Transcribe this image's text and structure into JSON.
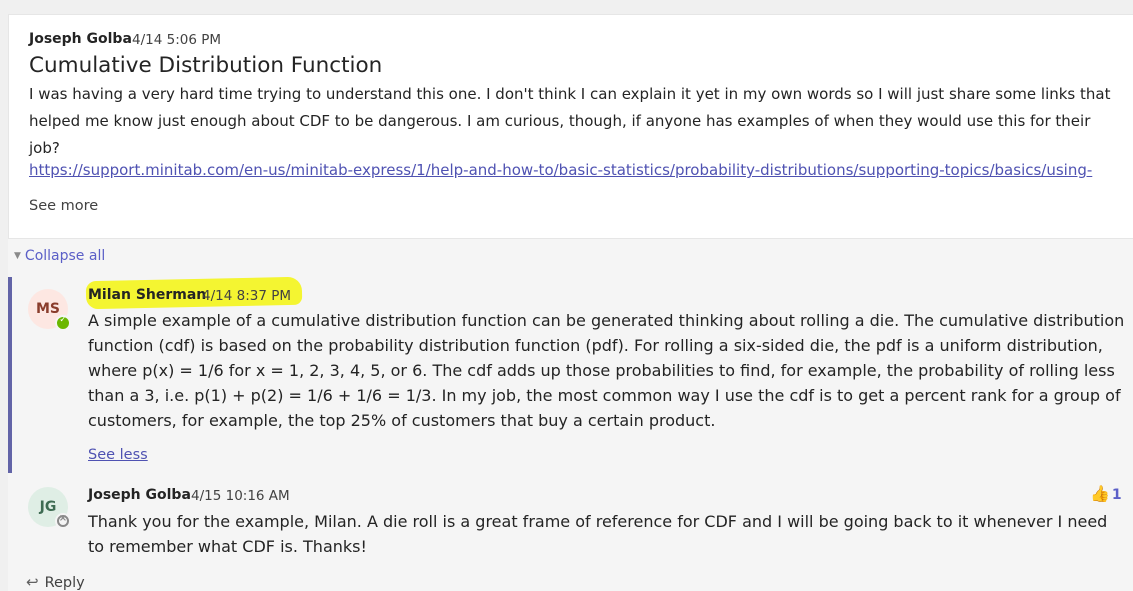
{
  "post": {
    "author": "Joseph Golba",
    "time": "4/14 5:06 PM",
    "title": "Cumulative Distribution Function",
    "body": "I was having a very hard time trying to understand this one.  I don't think I can explain it yet in my own words so I will just share some links that helped me know just enough about CDF to be dangerous.  I am curious, though, if anyone has examples of when they would use this for their job?",
    "link": "https://support.minitab.com/en-us/minitab-express/1/help-and-how-to/basic-statistics/probability-distributions/supporting-topics/basics/using-",
    "see_more": "See more"
  },
  "thread": {
    "collapse_all": "Collapse all",
    "replies": [
      {
        "initials": "MS",
        "author": "Milan Sherman",
        "time": "4/14 8:37 PM",
        "body": "A simple example of a cumulative distribution function can be generated thinking about rolling a die.  The cumulative distribution function (cdf) is based on the probability distribution function (pdf).  For rolling a six-sided die, the pdf is a uniform distribution, where p(x) = 1/6 for x = 1, 2, 3, 4, 5, or 6.  The cdf adds up those probabilities to find, for example, the probability of rolling less than a 3, i.e. p(1) + p(2) = 1/6 + 1/6 = 1/3.  In my job, the most common way I use the cdf is to get a percent rank for a group of customers, for example, the top 25% of customers that buy a certain product.",
        "see_less": "See less"
      },
      {
        "initials": "JG",
        "author": "Joseph Golba",
        "time": "4/15 10:16 AM",
        "body": "Thank you for the example, Milan.  A die roll is a great frame of reference for CDF and I will be going back to it whenever I need to remember what CDF is.  Thanks!",
        "reaction_count": "1"
      }
    ],
    "reply_label": "Reply"
  },
  "icons": {
    "reaction": "thumbs-up-icon",
    "reply": "reply-arrow-icon",
    "collapse": "caret-down-icon"
  },
  "colors": {
    "accent": "#6264a7",
    "link": "#4f52b2",
    "highlight": "#f4f531",
    "online": "#6bb700"
  }
}
